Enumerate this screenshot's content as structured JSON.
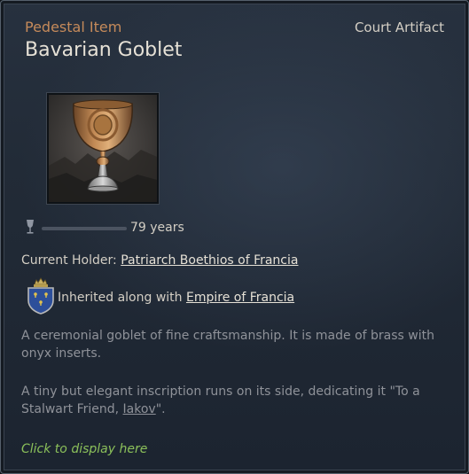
{
  "tooltip": {
    "category": "Pedestal Item",
    "artifact_type": "Court Artifact",
    "title": "Bavarian Goblet",
    "item_icon": "goblet-icon",
    "durability": {
      "icon": "wine-glass-icon",
      "value_text": "79 years"
    },
    "holder": {
      "label": "Current Holder:",
      "name": "Patriarch Boethios of Francia"
    },
    "inheritance": {
      "coat_of_arms_icon": "coat-of-arms-icon",
      "text": "Inherited along with",
      "title_link": "Empire of Francia"
    },
    "description": {
      "paragraph1": "A ceremonial goblet of fine craftsmanship. It is made of brass with onyx inserts.",
      "paragraph2_before": "A tiny but elegant inscription runs on its side, dedicating it \"To a Stalwart Friend, ",
      "paragraph2_link": "Iakov",
      "paragraph2_after": "\"."
    },
    "action_hint": "Click to display here"
  },
  "colors": {
    "category": "#c58a5a",
    "action_hint": "#8bc05a",
    "description": "#8f9299",
    "background": "#222b37"
  }
}
